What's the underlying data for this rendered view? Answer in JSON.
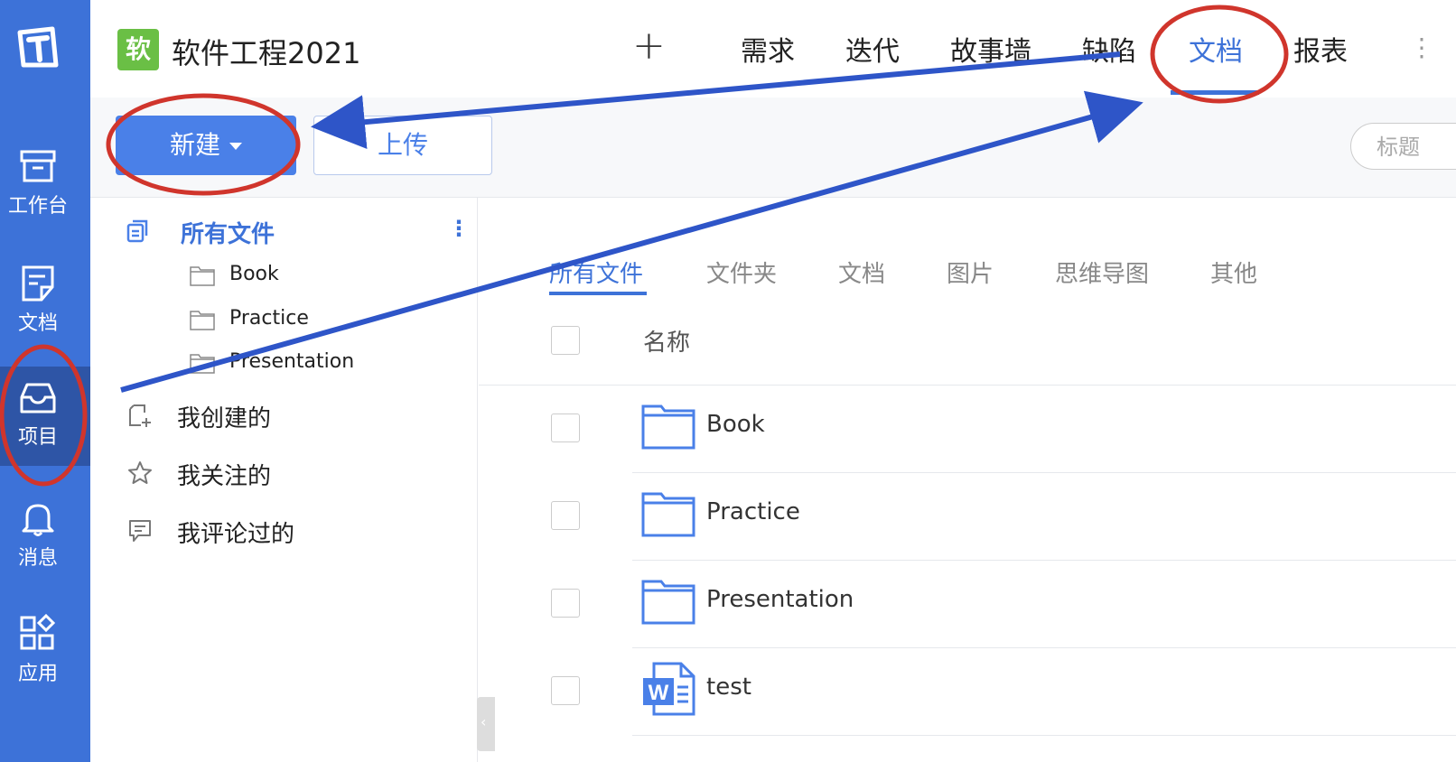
{
  "rail": {
    "items": [
      {
        "label": "工作台",
        "icon": "archive-icon"
      },
      {
        "label": "文档",
        "icon": "document-icon"
      },
      {
        "label": "项目",
        "icon": "inbox-icon"
      },
      {
        "label": "消息",
        "icon": "bell-icon"
      },
      {
        "label": "应用",
        "icon": "apps-grid-icon"
      }
    ],
    "active_index": 2
  },
  "header": {
    "project_badge": "软",
    "project_title": "软件工程2021",
    "plus_label": "+",
    "nav": [
      {
        "label": "需求"
      },
      {
        "label": "迭代"
      },
      {
        "label": "故事墙"
      },
      {
        "label": "缺陷"
      },
      {
        "label": "文档"
      },
      {
        "label": "报表"
      }
    ],
    "active_nav": "文档"
  },
  "toolbar": {
    "new_label": "新建",
    "upload_label": "上传",
    "search_placeholder": "标题"
  },
  "tree": {
    "all_files": "所有文件",
    "folders": [
      {
        "label": "Book"
      },
      {
        "label": "Practice"
      },
      {
        "label": "Presentation"
      }
    ],
    "created_by_me": "我创建的",
    "followed": "我关注的",
    "commented": "我评论过的"
  },
  "main": {
    "filter_tabs": [
      {
        "label": "所有文件"
      },
      {
        "label": "文件夹"
      },
      {
        "label": "文档"
      },
      {
        "label": "图片"
      },
      {
        "label": "思维导图"
      },
      {
        "label": "其他"
      }
    ],
    "active_filter": "所有文件",
    "column_name": "名称",
    "files": [
      {
        "name": "Book",
        "type": "folder"
      },
      {
        "name": "Practice",
        "type": "folder"
      },
      {
        "name": "Presentation",
        "type": "folder"
      },
      {
        "name": "test",
        "type": "word"
      }
    ]
  },
  "annotation_color": "#d0352c",
  "arrow_color": "#2e55c8"
}
